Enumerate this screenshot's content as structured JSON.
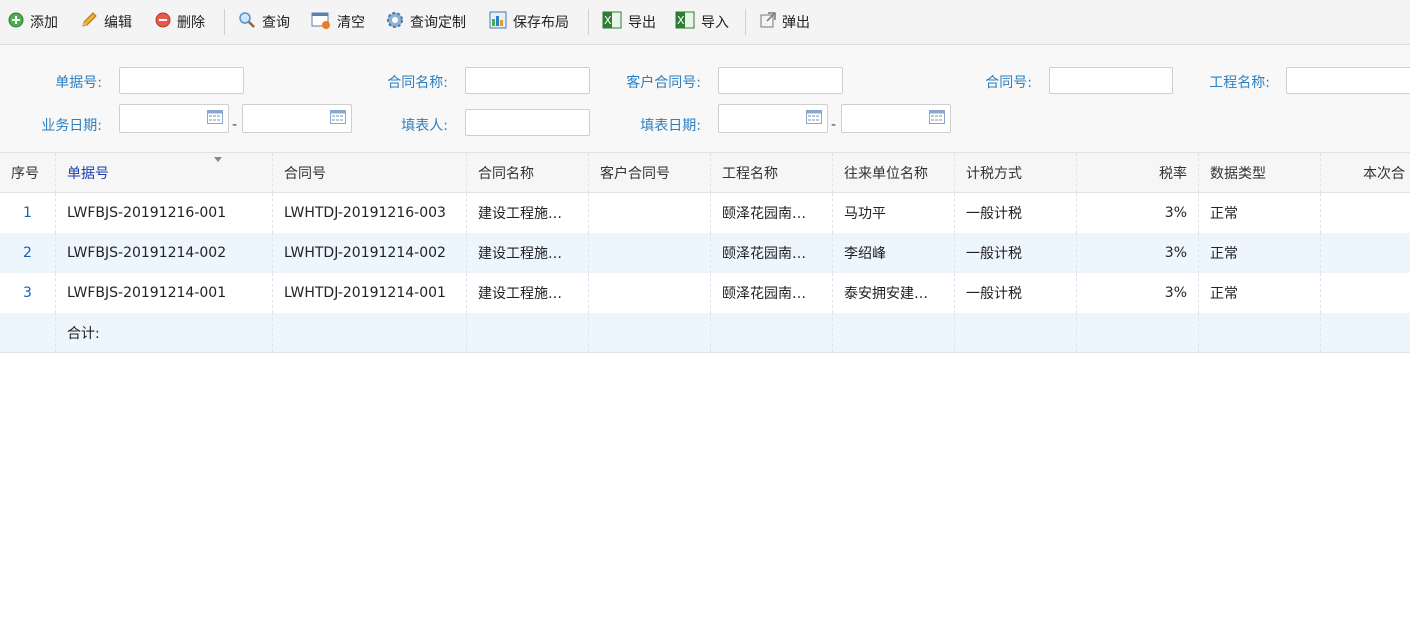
{
  "toolbar": {
    "add": "添加",
    "edit": "编辑",
    "delete": "删除",
    "query": "查询",
    "clear": "清空",
    "query_custom": "查询定制",
    "save_layout": "保存布局",
    "export": "导出",
    "import": "导入",
    "popup": "弹出"
  },
  "filters": {
    "doc_no": "单据号:",
    "contract_name": "合同名称:",
    "customer_contract_no": "客户合同号:",
    "contract_no": "合同号:",
    "project_name": "工程名称:",
    "business_date": "业务日期:",
    "filler": "填表人:",
    "fill_date": "填表日期:",
    "range_sep": "-"
  },
  "table": {
    "headers": [
      "序号",
      "单据号",
      "合同号",
      "合同名称",
      "客户合同号",
      "工程名称",
      "往来单位名称",
      "计税方式",
      "税率",
      "数据类型",
      "本次合"
    ],
    "rows": [
      [
        "1",
        "LWFBJS-20191216-001",
        "LWHTDJ-20191216-003",
        "建设工程施…",
        "",
        "颐泽花园南…",
        "马功平",
        "一般计税",
        "3%",
        "正常",
        ""
      ],
      [
        "2",
        "LWFBJS-20191214-002",
        "LWHTDJ-20191214-002",
        "建设工程施…",
        "",
        "颐泽花园南…",
        "李绍峰",
        "一般计税",
        "3%",
        "正常",
        ""
      ],
      [
        "3",
        "LWFBJS-20191214-001",
        "LWHTDJ-20191214-001",
        "建设工程施…",
        "",
        "颐泽花园南…",
        "泰安拥安建…",
        "一般计税",
        "3%",
        "正常",
        ""
      ]
    ],
    "sum_label": "合计:"
  },
  "colors": {
    "label_blue": "#2d7fc1",
    "row_alt": "#eef6fd",
    "toolbar_bg": "#f4f4f4"
  }
}
